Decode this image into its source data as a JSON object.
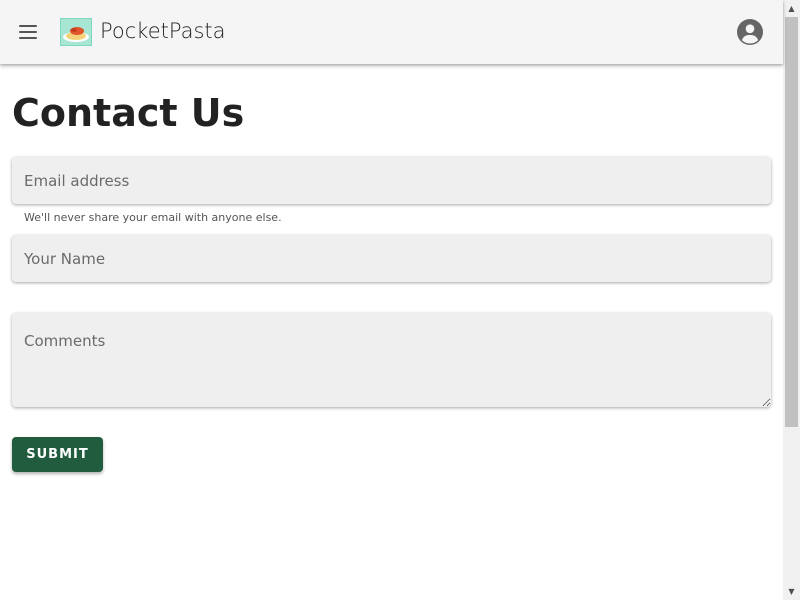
{
  "app_bar": {
    "title": "PocketPasta",
    "menu_icon": "hamburger-menu-icon",
    "logo_icon": "pasta-plate-logo",
    "account_icon": "account-circle-icon",
    "background": "#f5f5f5"
  },
  "page": {
    "title": "Contact Us"
  },
  "form": {
    "email": {
      "placeholder": "Email address",
      "value": "",
      "help_text": "We'll never share your email with anyone else."
    },
    "name": {
      "placeholder": "Your Name",
      "value": ""
    },
    "comments": {
      "placeholder": "Comments",
      "value": ""
    },
    "submit_label": "SUBMIT",
    "submit_color": "#215c3e"
  },
  "scrollbar": {
    "up_icon": "scroll-up-arrow-icon",
    "down_icon": "scroll-down-arrow-icon"
  }
}
